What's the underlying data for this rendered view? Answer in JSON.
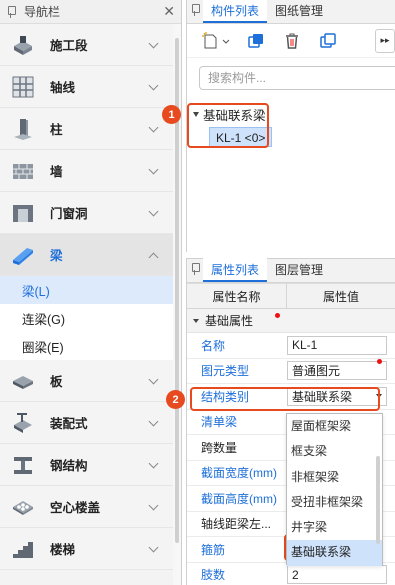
{
  "nav": {
    "title": "导航栏",
    "close": "✕",
    "items": [
      {
        "label": "施工段",
        "icon": "construction-section-icon"
      },
      {
        "label": "轴线",
        "icon": "axis-grid-icon"
      },
      {
        "label": "柱",
        "icon": "column-icon"
      },
      {
        "label": "墙",
        "icon": "wall-icon"
      },
      {
        "label": "门窗洞",
        "icon": "door-window-icon"
      },
      {
        "label": "梁",
        "icon": "beam-icon"
      },
      {
        "label": "板",
        "icon": "slab-icon"
      },
      {
        "label": "装配式",
        "icon": "prefab-icon"
      },
      {
        "label": "钢结构",
        "icon": "steel-structure-icon"
      },
      {
        "label": "空心楼盖",
        "icon": "hollow-floor-icon"
      },
      {
        "label": "楼梯",
        "icon": "stair-icon"
      }
    ],
    "sub": [
      {
        "label": "梁(L)"
      },
      {
        "label": "连梁(G)"
      },
      {
        "label": "圈梁(E)"
      }
    ]
  },
  "components": {
    "tabs": [
      "构件列表",
      "图纸管理"
    ],
    "search_placeholder": "搜索构件...",
    "tree_parent": "基础联系梁",
    "tree_leaf": "KL-1 <0>"
  },
  "badges": [
    "1",
    "2"
  ],
  "properties": {
    "tabs": [
      "属性列表",
      "图层管理"
    ],
    "col_name": "属性名称",
    "col_value": "属性值",
    "group": "基础属性",
    "rows": [
      {
        "key": "名称",
        "value": "KL-1"
      },
      {
        "key": "图元类型",
        "value": "普通图元"
      },
      {
        "key": "结构类别",
        "value": "基础联系梁"
      },
      {
        "key": "清单梁",
        "value": ""
      },
      {
        "key": "跨数量",
        "value": ""
      },
      {
        "key": "截面宽度(mm)",
        "value": ""
      },
      {
        "key": "截面高度(mm)",
        "value": ""
      },
      {
        "key": "轴线距梁左...",
        "value": ""
      },
      {
        "key": "箍筋",
        "value": ""
      },
      {
        "key": "肢数",
        "value": "2"
      }
    ],
    "dropdown_options": [
      "屋面框架梁",
      "框支梁",
      "非框架梁",
      "受扭非框架梁",
      "井字梁",
      "基础联系梁"
    ]
  },
  "colors": {
    "accent": "#1e6fd9",
    "highlight": "#e74a1f"
  }
}
